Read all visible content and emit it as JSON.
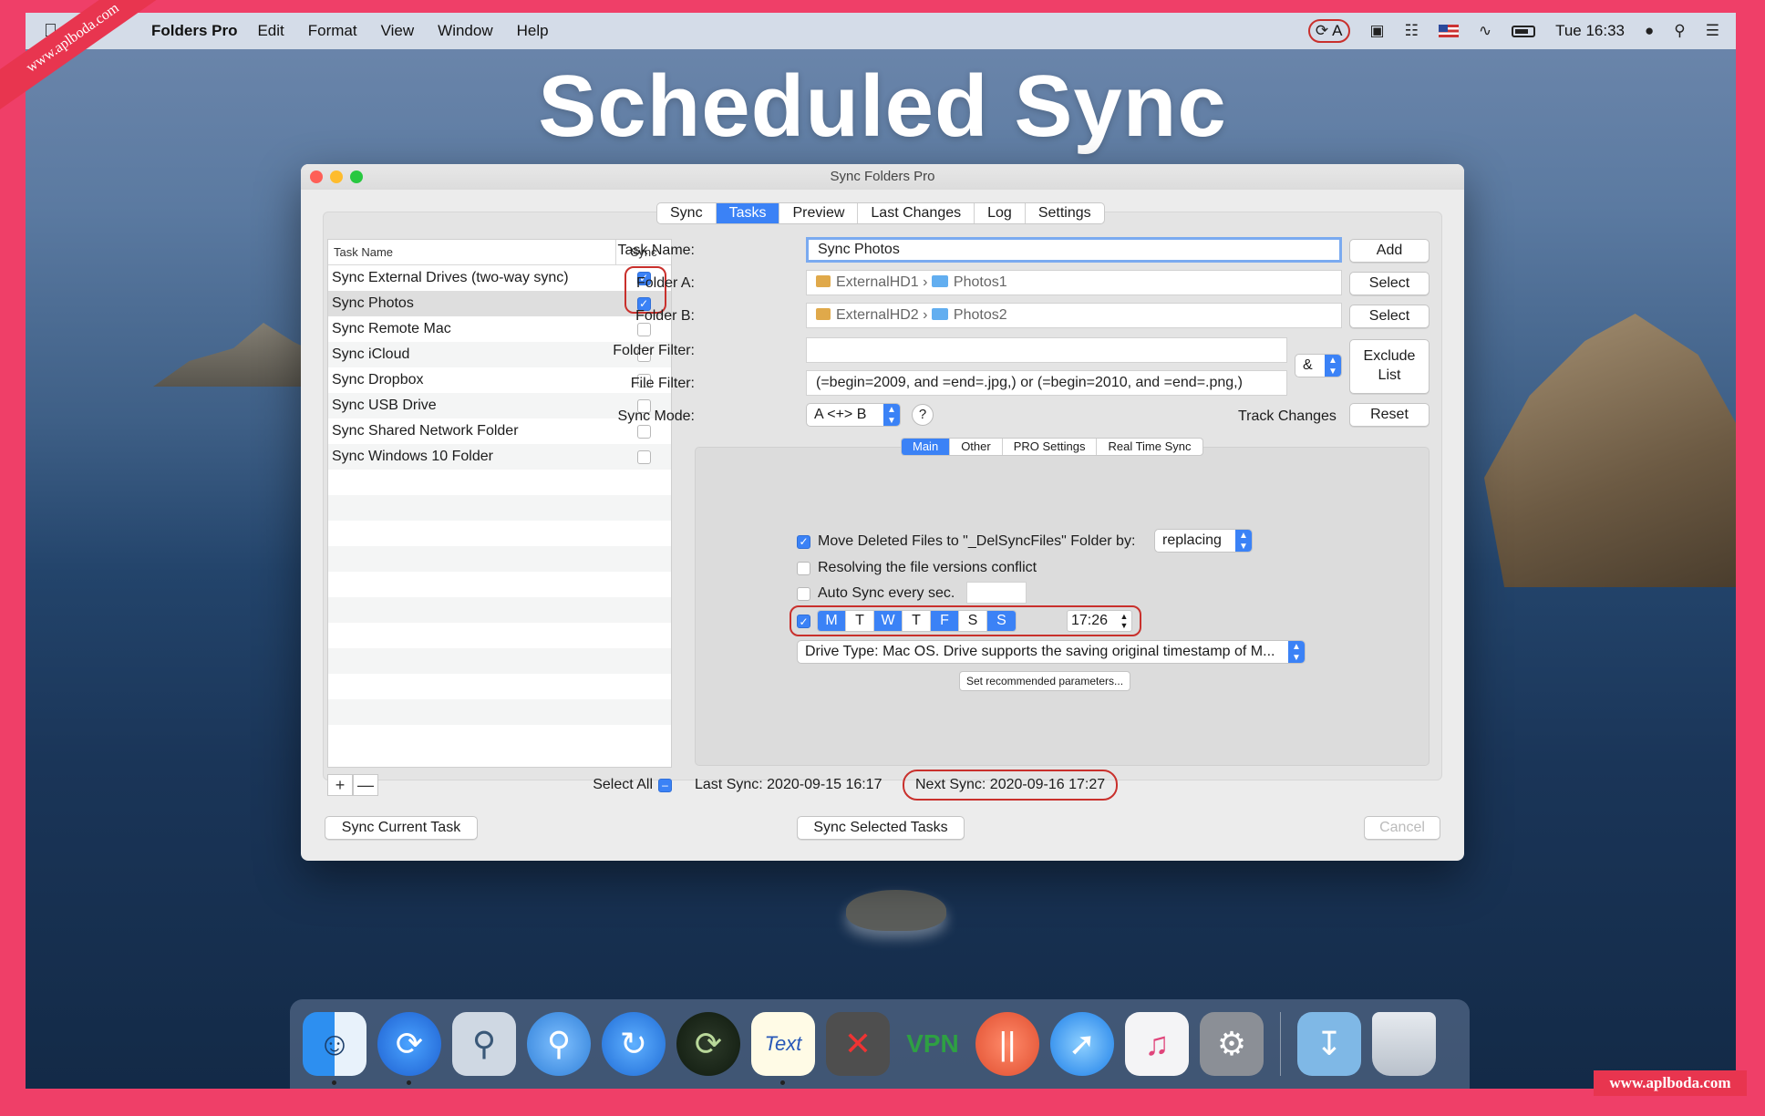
{
  "banner": {
    "title": "Scheduled Sync"
  },
  "watermarks": {
    "top_left": "www.aplboda.com",
    "bottom_right": "www.aplboda.com"
  },
  "menubar": {
    "app_name": "Folders Pro",
    "items": [
      "Edit",
      "Format",
      "View",
      "Window",
      "Help"
    ],
    "sync_indicator_letter": "A",
    "clock": "Tue 16:33"
  },
  "window": {
    "title": "Sync Folders Pro",
    "tabs": [
      {
        "label": "Sync",
        "active": false
      },
      {
        "label": "Tasks",
        "active": true
      },
      {
        "label": "Preview",
        "active": false
      },
      {
        "label": "Last Changes",
        "active": false
      },
      {
        "label": "Log",
        "active": false
      },
      {
        "label": "Settings",
        "active": false
      }
    ],
    "task_list": {
      "header_name": "Task Name",
      "header_sync": "Sync",
      "rows": [
        {
          "name": "Sync External Drives (two-way sync)",
          "checked": true
        },
        {
          "name": "Sync Photos",
          "checked": true,
          "selected": true
        },
        {
          "name": "Sync Remote Mac",
          "checked": false
        },
        {
          "name": "Sync iCloud",
          "checked": false
        },
        {
          "name": "Sync Dropbox",
          "checked": false
        },
        {
          "name": "Sync USB Drive",
          "checked": false
        },
        {
          "name": "Sync Shared Network Folder",
          "checked": false
        },
        {
          "name": "Sync Windows 10 Folder",
          "checked": false
        }
      ],
      "add_symbol": "+",
      "remove_symbol": "—",
      "select_all_label": "Select All"
    },
    "form": {
      "task_name_label": "Task Name:",
      "task_name_value": "Sync Photos",
      "add_button": "Add",
      "folder_a_label": "Folder A:",
      "folder_a_drive": "ExternalHD1",
      "folder_a_folder": "Photos1",
      "folder_b_label": "Folder B:",
      "folder_b_drive": "ExternalHD2",
      "folder_b_folder": "Photos2",
      "select_button": "Select",
      "folder_filter_label": "Folder Filter:",
      "folder_filter_value": "",
      "file_filter_label": "File Filter:",
      "file_filter_value": "(=begin=2009, and =end=.jpg,) or (=begin=2010, and =end=.png,)",
      "operator_value": "&",
      "exclude_list_button_line1": "Exclude",
      "exclude_list_button_line2": "List",
      "sync_mode_label": "Sync Mode:",
      "sync_mode_value": "A <+> B",
      "help_symbol": "?",
      "track_changes_label": "Track Changes",
      "reset_button": "Reset"
    },
    "subtabs": [
      {
        "label": "Main",
        "active": true
      },
      {
        "label": "Other",
        "active": false
      },
      {
        "label": "PRO Settings",
        "active": false
      },
      {
        "label": "Real Time Sync",
        "active": false
      }
    ],
    "main_panel": {
      "move_deleted_label": "Move Deleted Files to \"_DelSyncFiles\" Folder by:",
      "move_deleted_checked": true,
      "move_deleted_mode": "replacing",
      "resolve_label": "Resolving the file versions conflict",
      "resolve_checked": false,
      "auto_sync_label": "Auto Sync every sec.",
      "auto_sync_checked": false,
      "auto_sync_value": "",
      "schedule_checked": true,
      "days": [
        {
          "label": "M",
          "on": true
        },
        {
          "label": "T",
          "on": false
        },
        {
          "label": "W",
          "on": true
        },
        {
          "label": "T",
          "on": false
        },
        {
          "label": "F",
          "on": true
        },
        {
          "label": "S",
          "on": false
        },
        {
          "label": "S",
          "on": true
        }
      ],
      "schedule_time": "17:26",
      "drive_type": "Drive Type: Mac OS. Drive supports the saving original timestamp of M...",
      "recommended_button": "Set recommended parameters..."
    },
    "status": {
      "last_sync": "Last Sync: 2020-09-15 16:17",
      "next_sync": "Next Sync: 2020-09-16 17:27"
    },
    "bottom_buttons": {
      "sync_current": "Sync Current Task",
      "sync_selected": "Sync Selected Tasks",
      "cancel": "Cancel"
    }
  },
  "dock": {
    "apps": [
      "finder-icon",
      "sync-icon",
      "magnifier-icon",
      "search-icon",
      "refresh-icon",
      "binary-sync-icon",
      "text-edit-icon",
      "trash-can-icon",
      "vpn-icon",
      "fork-knife-icon",
      "compass-icon",
      "music-icon",
      "gear-icon"
    ],
    "vpn_label": "VPN",
    "text_label": "Text"
  },
  "colors": {
    "accent": "#3b82f6",
    "highlight": "#c9302c",
    "border_pink": "#ef3f68"
  }
}
